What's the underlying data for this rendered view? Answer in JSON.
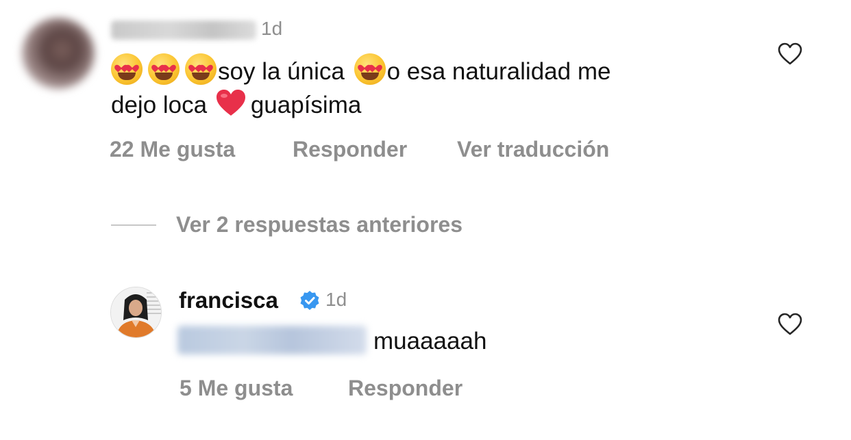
{
  "comment": {
    "timestamp": "1d",
    "text_part1": "soy la única",
    "text_part2": "o esa naturalidad me",
    "text_part3": "dejo loca",
    "text_part4": "guapísima",
    "likes": "22 Me gusta",
    "reply_label": "Responder",
    "translate_label": "Ver traducción",
    "emoji_icon": "heart-eyes-emoji",
    "heart_color": "#e8304a"
  },
  "view_replies_label": "Ver 2 respuestas anteriores",
  "reply": {
    "username": "francisca",
    "timestamp": "1d",
    "text": "muaaaaah",
    "likes": "5 Me gusta",
    "reply_label": "Responder",
    "verified_color": "#3897f0"
  },
  "colors": {
    "secondary_text": "#8e8e8e",
    "primary_text": "#111111"
  }
}
